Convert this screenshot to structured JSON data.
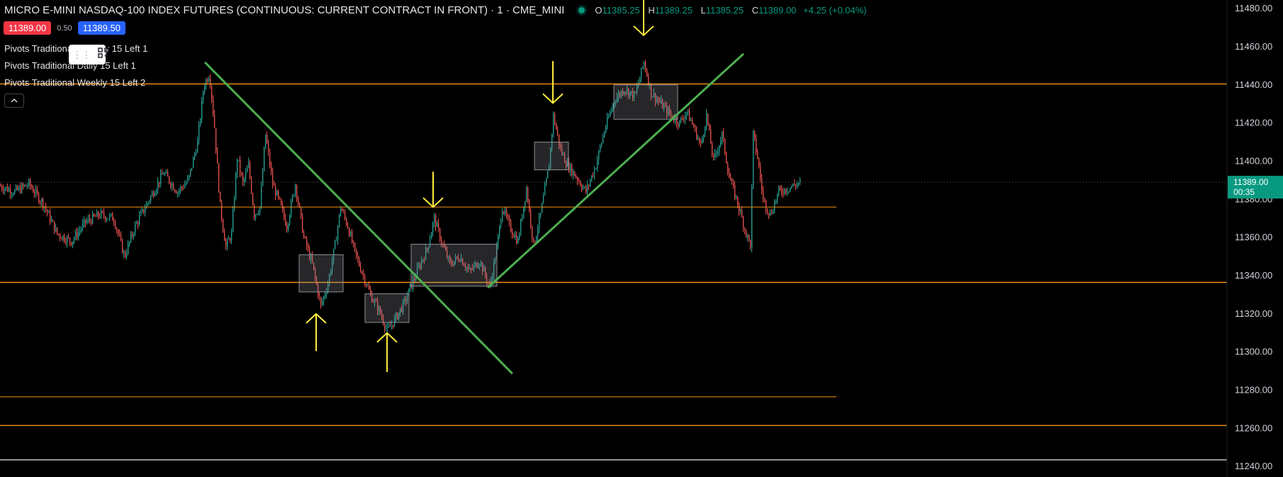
{
  "header": {
    "title": "MICRO E-MINI NASDAQ-100 INDEX FUTURES (CONTINUOUS: CURRENT CONTRACT IN FRONT) · 1 · CME_MINI",
    "ohlc": {
      "o_label": "O",
      "o": "11385.25",
      "h_label": "H",
      "h": "11389.25",
      "l_label": "L",
      "l": "11385.25",
      "c_label": "C",
      "c": "11389.00",
      "change": "+4.25 (+0.04%)"
    }
  },
  "quote": {
    "bid": "11389.00",
    "spread": "0.50",
    "ask": "11389.50"
  },
  "legend": [
    "Pivots Traditional Monthly 15 Left 1",
    "Pivots Traditional Daily 15 Left 1",
    "Pivots Traditional Weekly 15 Left 2"
  ],
  "colors": {
    "up": "#26a69a",
    "down": "#ef5350",
    "pivot": "#f7931a",
    "trend": "#4caf50",
    "arrow": "#ffeb3b",
    "last_price": "#089981",
    "axis_text": "#d1d4dc"
  },
  "price_axis": {
    "ticks": [
      "11240.00",
      "11260.00",
      "11280.00",
      "11300.00",
      "11320.00",
      "11340.00",
      "11360.00",
      "11380.00",
      "11400.00",
      "11420.00",
      "11440.00",
      "11460.00",
      "11480.00"
    ],
    "last_price_label": "11389.00",
    "countdown": "00:35"
  },
  "chart_data": {
    "type": "candlestick",
    "title": "MICRO E-MINI NASDAQ-100 INDEX FUTURES (CONTINUOUS: CURRENT CONTRACT IN FRONT) · 1 · CME_MINI",
    "xlabel": "",
    "ylabel": "",
    "ylim": [
      11234.5,
      11484.5
    ],
    "grid": false,
    "last_price": 11389.0,
    "series_path": [
      [
        0,
        11387
      ],
      [
        20,
        11384
      ],
      [
        40,
        11388
      ],
      [
        60,
        11378
      ],
      [
        80,
        11362
      ],
      [
        100,
        11358
      ],
      [
        120,
        11368
      ],
      [
        140,
        11372
      ],
      [
        160,
        11370
      ],
      [
        175,
        11350
      ],
      [
        190,
        11366
      ],
      [
        210,
        11380
      ],
      [
        230,
        11394
      ],
      [
        250,
        11384
      ],
      [
        265,
        11390
      ],
      [
        278,
        11410
      ],
      [
        287,
        11440
      ],
      [
        295,
        11446
      ],
      [
        302,
        11418
      ],
      [
        310,
        11376
      ],
      [
        318,
        11355
      ],
      [
        326,
        11362
      ],
      [
        334,
        11402
      ],
      [
        342,
        11388
      ],
      [
        350,
        11398
      ],
      [
        358,
        11372
      ],
      [
        366,
        11376
      ],
      [
        374,
        11414
      ],
      [
        384,
        11388
      ],
      [
        394,
        11378
      ],
      [
        404,
        11366
      ],
      [
        416,
        11388
      ],
      [
        428,
        11360
      ],
      [
        440,
        11346
      ],
      [
        452,
        11324
      ],
      [
        462,
        11336
      ],
      [
        472,
        11356
      ],
      [
        480,
        11376
      ],
      [
        490,
        11366
      ],
      [
        500,
        11352
      ],
      [
        512,
        11340
      ],
      [
        522,
        11330
      ],
      [
        534,
        11322
      ],
      [
        546,
        11311
      ],
      [
        558,
        11318
      ],
      [
        570,
        11326
      ],
      [
        582,
        11337
      ],
      [
        592,
        11346
      ],
      [
        602,
        11354
      ],
      [
        612,
        11370
      ],
      [
        622,
        11358
      ],
      [
        634,
        11346
      ],
      [
        648,
        11350
      ],
      [
        662,
        11342
      ],
      [
        676,
        11348
      ],
      [
        690,
        11334
      ],
      [
        700,
        11354
      ],
      [
        708,
        11376
      ],
      [
        718,
        11366
      ],
      [
        730,
        11358
      ],
      [
        742,
        11386
      ],
      [
        752,
        11356
      ],
      [
        762,
        11372
      ],
      [
        774,
        11398
      ],
      [
        780,
        11424
      ],
      [
        790,
        11406
      ],
      [
        800,
        11398
      ],
      [
        812,
        11392
      ],
      [
        826,
        11384
      ],
      [
        840,
        11398
      ],
      [
        852,
        11416
      ],
      [
        866,
        11432
      ],
      [
        880,
        11438
      ],
      [
        895,
        11434
      ],
      [
        908,
        11452
      ],
      [
        918,
        11436
      ],
      [
        932,
        11430
      ],
      [
        946,
        11424
      ],
      [
        958,
        11420
      ],
      [
        968,
        11426
      ],
      [
        978,
        11418
      ],
      [
        988,
        11408
      ],
      [
        996,
        11424
      ],
      [
        1006,
        11400
      ],
      [
        1018,
        11414
      ],
      [
        1028,
        11392
      ],
      [
        1040,
        11378
      ],
      [
        1052,
        11362
      ],
      [
        1058,
        11356
      ],
      [
        1062,
        11414
      ],
      [
        1068,
        11402
      ],
      [
        1076,
        11380
      ],
      [
        1086,
        11372
      ],
      [
        1098,
        11384
      ],
      [
        1112,
        11386
      ],
      [
        1128,
        11389
      ]
    ],
    "pivot_levels": [
      {
        "price": 11440.5,
        "extends": "full"
      },
      {
        "price": 11376.0,
        "extends": "partial"
      },
      {
        "price": 11336.5,
        "extends": "full"
      },
      {
        "price": 11276.5,
        "extends": "partial"
      },
      {
        "price": 11261.5,
        "extends": "full"
      },
      {
        "price": 11243.5,
        "extends": "full",
        "color": "#d1d4dc"
      }
    ],
    "trend_lines": [
      {
        "from": [
          290,
          11451.5
        ],
        "to": [
          722,
          11289.0
        ]
      },
      {
        "from": [
          689,
          11334.0
        ],
        "to": [
          1048,
          11456.0
        ]
      }
    ],
    "consolidation_boxes": [
      {
        "x0": 422,
        "x1": 484,
        "p0": 11351.0,
        "p1": 11331.5
      },
      {
        "x0": 515,
        "x1": 577,
        "p0": 11330.5,
        "p1": 11315.5
      },
      {
        "x0": 580,
        "x1": 701,
        "p0": 11356.5,
        "p1": 11334.5
      },
      {
        "x0": 754,
        "x1": 802,
        "p0": 11410.0,
        "p1": 11395.5
      },
      {
        "x0": 866,
        "x1": 956,
        "p0": 11440.0,
        "p1": 11422.0
      }
    ],
    "arrows": [
      {
        "x": 446,
        "dir": "up",
        "tip_price": 11320.0,
        "tail_price": 11300.5
      },
      {
        "x": 546,
        "dir": "up",
        "tip_price": 11310.0,
        "tail_price": 11289.5
      },
      {
        "x": 611,
        "dir": "down",
        "tip_price": 11376.0,
        "tail_price": 11394.5
      },
      {
        "x": 780,
        "dir": "down",
        "tip_price": 11430.5,
        "tail_price": 11452.5
      },
      {
        "x": 908,
        "dir": "down",
        "tip_price": 11466.0,
        "tail_price": 11487.0
      }
    ]
  }
}
